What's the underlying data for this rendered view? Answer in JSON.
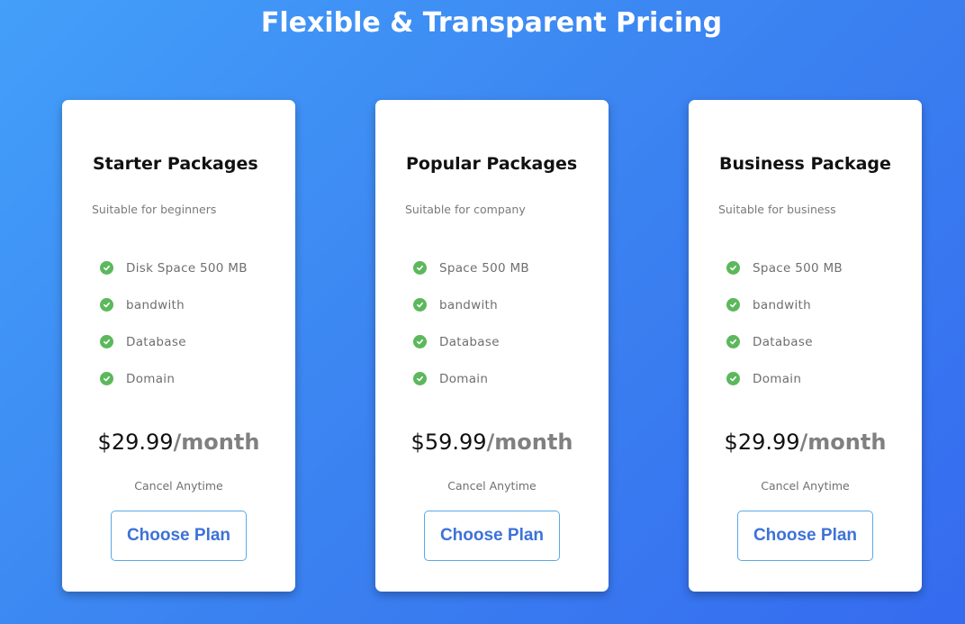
{
  "page": {
    "title": "Flexible & Transparent Pricing"
  },
  "colors": {
    "background_start": "#439ff9",
    "background_end": "#356bef",
    "check": "#5cb85c",
    "button_text": "#3d72d8",
    "button_border": "#5aa9e6"
  },
  "plans": [
    {
      "name": "Starter Packages",
      "description": "Suitable for beginners",
      "features": [
        "Disk Space 500 MB",
        "bandwith",
        "Database",
        "Domain"
      ],
      "price": "$29.99",
      "period": "/month",
      "note": "Cancel Anytime",
      "button_label": "Choose Plan",
      "feature_icon": "check-circle-icon"
    },
    {
      "name": "Popular Packages",
      "description": "Suitable for company",
      "features": [
        "Space 500 MB",
        "bandwith",
        "Database",
        "Domain"
      ],
      "price": "$59.99",
      "period": "/month",
      "note": "Cancel Anytime",
      "button_label": "Choose Plan",
      "feature_icon": "check-circle-icon"
    },
    {
      "name": "Business Package",
      "description": "Suitable for business",
      "features": [
        "Space 500 MB",
        "bandwith",
        "Database",
        "Domain"
      ],
      "price": "$29.99",
      "period": "/month",
      "note": "Cancel Anytime",
      "button_label": "Choose Plan",
      "feature_icon": "check-circle-icon"
    }
  ]
}
